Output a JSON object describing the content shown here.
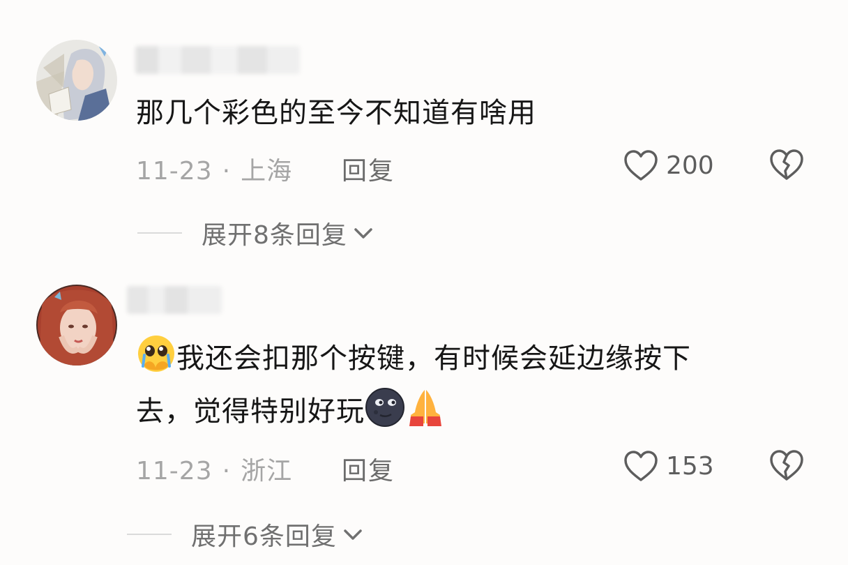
{
  "comments": [
    {
      "text": "那几个彩色的至今不知道有啥用",
      "date": "11-23",
      "separator": "·",
      "location": "上海",
      "reply_label": "回复",
      "like_count": "200",
      "expand_label": "展开8条回复"
    },
    {
      "emoji_start": "pleading-face-crying",
      "text_line1": "我还会扣那个按键，有时候会延边缘按下",
      "text_line2": "去，觉得特别好玩",
      "emoji_end": [
        "new-moon-face",
        "folded-hands"
      ],
      "date": "11-23",
      "separator": "·",
      "location": "浙江",
      "reply_label": "回复",
      "like_count": "153",
      "expand_label": "展开6条回复"
    }
  ],
  "icons": {
    "like": "heart-outline-icon",
    "dislike": "broken-heart-icon",
    "expand": "chevron-down-icon"
  },
  "colors": {
    "background": "#fdfcfb",
    "text_primary": "#161616",
    "text_meta": "#a5a5a5"
  }
}
